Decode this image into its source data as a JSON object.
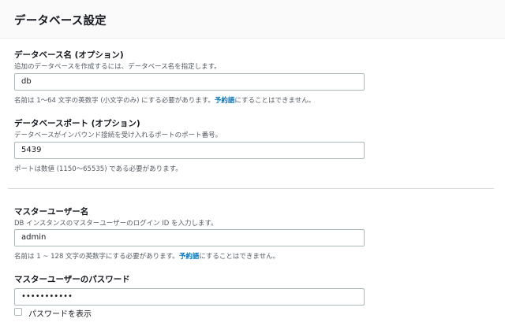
{
  "header": {
    "title": "データベース設定"
  },
  "db_name": {
    "label": "データベース名 (オプション)",
    "description": "追加のデータベースを作成するには、データベース名を指定します。",
    "value": "db",
    "hint_before": "名前は 1〜64 文字の英数字 (小文字のみ) にする必要があります。",
    "hint_link": "予約語",
    "hint_after": "にすることはできません。"
  },
  "db_port": {
    "label": "データベースポート (オプション)",
    "description": "データベースがインバウンド接続を受け入れるポートのポート番号。",
    "value": "5439",
    "hint": "ポートは数値 (1150〜65535) である必要があります。"
  },
  "master_user": {
    "label": "マスターユーザー名",
    "description": "DB インスタンスのマスターユーザーのログイン ID を入力します。",
    "value": "admin",
    "hint_before": "名前は 1 ~ 128 文字の英数字にする必要があります。",
    "hint_link": "予約語",
    "hint_after": "にすることはできません。"
  },
  "master_password": {
    "label": "マスターユーザーのパスワード",
    "value": "•••••••••••",
    "show_password_label": "パスワードを表示",
    "show_password_checked": false
  }
}
